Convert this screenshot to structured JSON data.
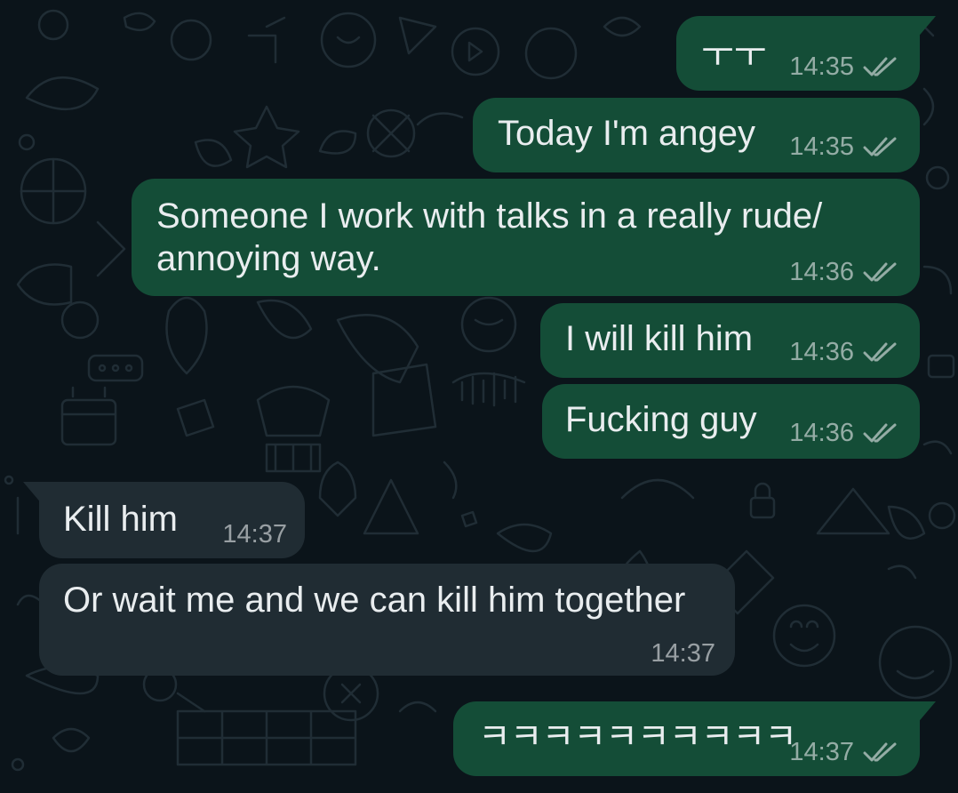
{
  "messages": [
    {
      "direction": "out",
      "text": "ㅜㅜ",
      "time": "14:35",
      "status": "read-ticks-icon"
    },
    {
      "direction": "out",
      "text": "Today I'm angey",
      "time": "14:35",
      "status": "read-ticks-icon"
    },
    {
      "direction": "out",
      "text": "Someone I work with talks in a really rude/",
      "text2": "annoying way.",
      "time": "14:36",
      "status": "read-ticks-icon"
    },
    {
      "direction": "out",
      "text": "I will kill him",
      "time": "14:36",
      "status": "read-ticks-icon"
    },
    {
      "direction": "out",
      "text": "Fucking guy",
      "time": "14:36",
      "status": "read-ticks-icon"
    },
    {
      "direction": "in",
      "text": "Kill him",
      "time": "14:37"
    },
    {
      "direction": "in",
      "text": "Or wait me and we can kill him together",
      "time": "14:37"
    },
    {
      "direction": "out",
      "text": "ㅋㅋㅋㅋㅋㅋㅋㅋㅋㅋ",
      "time": "14:37",
      "status": "read-ticks-icon"
    }
  ],
  "colors": {
    "background": "#0b141a",
    "outgoing_bubble": "#144d37",
    "incoming_bubble": "#202c33",
    "text": "#e9edef",
    "meta_text": "#9aa3a6"
  }
}
